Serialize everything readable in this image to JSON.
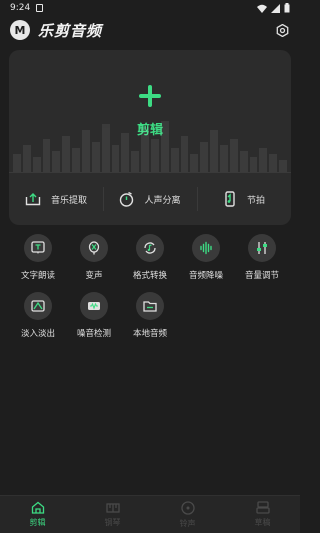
{
  "status": {
    "time": "9:24"
  },
  "app": {
    "logo_text": "M",
    "title": "乐剪音频"
  },
  "edit": {
    "label": "剪辑"
  },
  "quick_actions": [
    {
      "label": "音乐提取",
      "icon": "upload-tray-icon"
    },
    {
      "label": "人声分离",
      "icon": "stopwatch-icon"
    },
    {
      "label": "节拍",
      "icon": "phone-beat-icon"
    }
  ],
  "tools": [
    {
      "label": "文字朗读",
      "icon": "text-box-icon"
    },
    {
      "label": "变声",
      "icon": "mic-slash-icon"
    },
    {
      "label": "格式转换",
      "icon": "refresh-music-icon"
    },
    {
      "label": "音频降噪",
      "icon": "waveform-icon"
    },
    {
      "label": "音量调节",
      "icon": "sliders-icon"
    },
    {
      "label": "淡入淡出",
      "icon": "fade-icon"
    },
    {
      "label": "噪音检测",
      "icon": "noise-icon"
    },
    {
      "label": "本地音频",
      "icon": "folder-icon"
    }
  ],
  "nav": [
    {
      "label": "剪辑",
      "icon": "home-icon"
    },
    {
      "label": "钢琴",
      "icon": "piano-icon"
    },
    {
      "label": "铃声",
      "icon": "disc-icon"
    },
    {
      "label": "草稿",
      "icon": "drafts-icon"
    }
  ],
  "colors": {
    "accent": "#3ddc84",
    "background": "#1e1e1e",
    "card": "#2c2c2c",
    "icon_bg": "#3a3a3a"
  }
}
